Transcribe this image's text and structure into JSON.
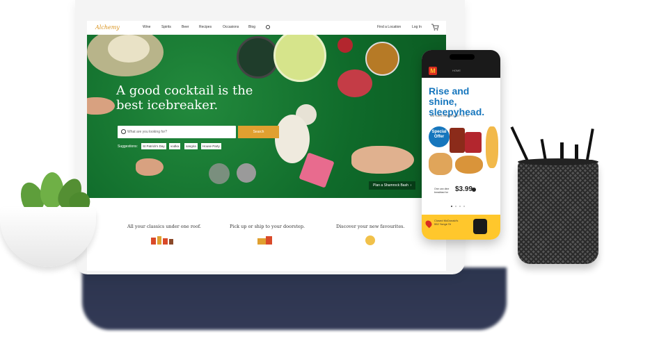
{
  "nav": {
    "logo": "Alchemy",
    "items": [
      "Wine",
      "Spirits",
      "Beer",
      "Recipes",
      "Occasions",
      "Blog"
    ],
    "find_location": "Find a Location",
    "login": "Log In"
  },
  "hero": {
    "title": "A good cocktail is the best icebreaker.",
    "search_placeholder": "What are you looking for?",
    "search_button": "Search",
    "suggestions_label": "Suggestions:",
    "suggestions": [
      "St Patrick's Day",
      "vodka",
      "sangria",
      "House Party"
    ],
    "cta": "Plan a Shamrock Bash"
  },
  "features": [
    "All your classics under one roof.",
    "Pick up or ship to your doorstep.",
    "Discover your new favourites."
  ],
  "phone": {
    "home_label": "HOME",
    "headline": "Rise and shine, sleepyhead.",
    "subhead": "WE HAVE BREAKFAST 'TIL 11",
    "offer": "Special Offer",
    "price_text": "One can dine breakfast for",
    "price": "$3.99",
    "store_status": "Closed McDonald's",
    "store_address": "552 Yonge St"
  },
  "colors": {
    "accent": "#e0a030",
    "hero_green": "#0f6a2a",
    "mcd_blue": "#1676bd",
    "mcd_yellow": "#ffc72c",
    "mcd_red": "#d92d20"
  }
}
